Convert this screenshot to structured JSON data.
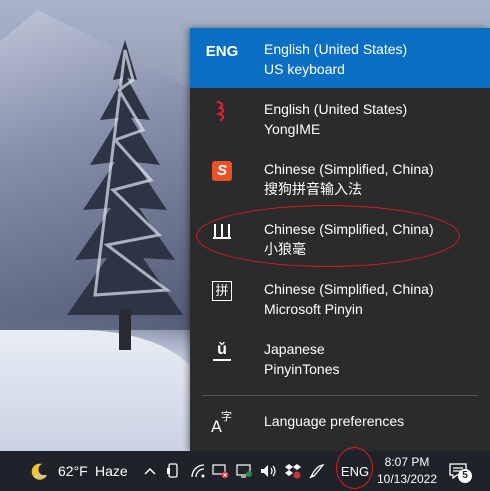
{
  "flyout": {
    "items": [
      {
        "icon_text": "ENG",
        "icon": "eng-text-icon",
        "title": "English (United States)",
        "subtitle": "US keyboard",
        "selected": true
      },
      {
        "icon_text": "",
        "icon": "yongime-icon",
        "title": "English (United States)",
        "subtitle": "YongIME",
        "selected": false
      },
      {
        "icon_text": "S",
        "icon": "sogou-icon",
        "title": "Chinese (Simplified, China)",
        "subtitle": "搜狗拼音输入法",
        "selected": false
      },
      {
        "icon_text": "",
        "icon": "xiaolanghao-icon",
        "title": "Chinese (Simplified, China)",
        "subtitle": "小狼毫",
        "selected": false
      },
      {
        "icon_text": "拼",
        "icon": "microsoft-pinyin-icon",
        "title": "Chinese (Simplified, China)",
        "subtitle": "Microsoft Pinyin",
        "selected": false
      },
      {
        "icon_text": "ǔ",
        "icon": "pinyintones-icon",
        "title": "Japanese",
        "subtitle": "PinyinTones",
        "selected": false
      }
    ],
    "preferences_label": "Language preferences"
  },
  "taskbar": {
    "weather_temp": "62°F",
    "weather_desc": "Haze",
    "language_indicator": "ENG",
    "time": "8:07 PM",
    "date": "10/13/2022",
    "notification_count": "5"
  },
  "colors": {
    "flyout_bg": "#2b2b2b",
    "selected_bg": "#0a6fc2",
    "annotation": "#e0191e",
    "taskbar_bg": "#1f2228"
  }
}
